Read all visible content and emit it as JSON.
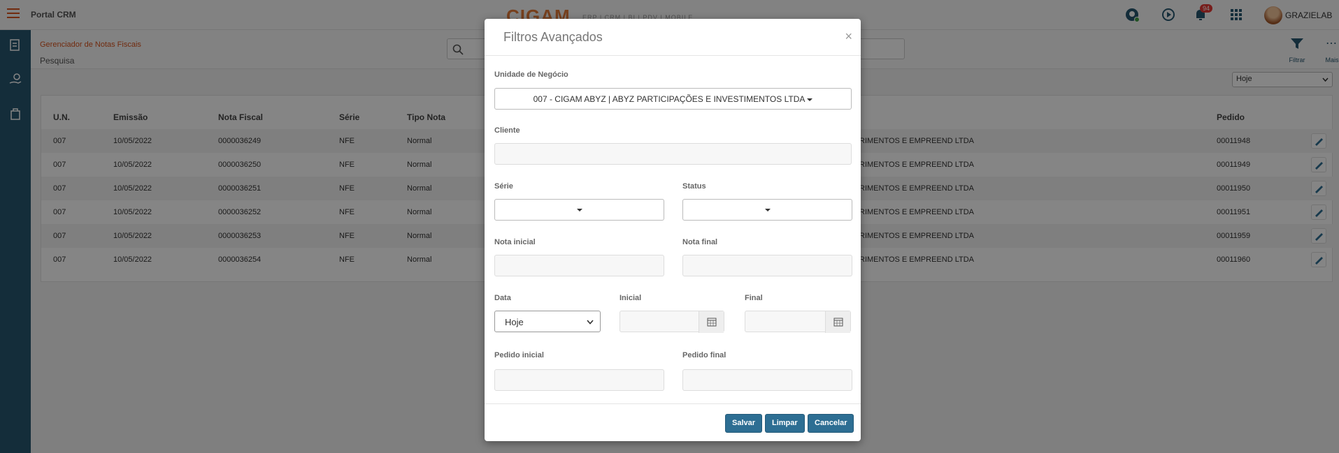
{
  "header": {
    "app_title": "Portal CRM",
    "brand": "CIGAM",
    "brand_sub": "ERP | CRM | BI | PDV | MOBILE",
    "notification_count": "94",
    "username": "GRAZIELAB"
  },
  "subheader": {
    "breadcrumb": "Gerenciador de Notas Fiscais",
    "title": "Pesquisa",
    "filter_label": "Filtrar",
    "more_label": "Mais"
  },
  "period_select": "Hoje",
  "table": {
    "headers": [
      "U.N.",
      "Emissão",
      "Nota Fiscal",
      "Série",
      "Tipo Nota",
      "Pedido"
    ],
    "rows": [
      {
        "un": "007",
        "emissao": "10/05/2022",
        "nota": "0000036249",
        "serie": "NFE",
        "tipo": "Normal",
        "cliente": "RIMENTOS E EMPREEND LTDA",
        "pedido": "00011948"
      },
      {
        "un": "007",
        "emissao": "10/05/2022",
        "nota": "0000036250",
        "serie": "NFE",
        "tipo": "Normal",
        "cliente": "RIMENTOS E EMPREEND LTDA",
        "pedido": "00011949"
      },
      {
        "un": "007",
        "emissao": "10/05/2022",
        "nota": "0000036251",
        "serie": "NFE",
        "tipo": "Normal",
        "cliente": "RIMENTOS E EMPREEND LTDA",
        "pedido": "00011950"
      },
      {
        "un": "007",
        "emissao": "10/05/2022",
        "nota": "0000036252",
        "serie": "NFE",
        "tipo": "Normal",
        "cliente": "RIMENTOS E EMPREEND LTDA",
        "pedido": "00011951"
      },
      {
        "un": "007",
        "emissao": "10/05/2022",
        "nota": "0000036253",
        "serie": "NFE",
        "tipo": "Normal",
        "cliente": "RIMENTOS E EMPREEND LTDA",
        "pedido": "00011959"
      },
      {
        "un": "007",
        "emissao": "10/05/2022",
        "nota": "0000036254",
        "serie": "NFE",
        "tipo": "Normal",
        "cliente": "RIMENTOS E EMPREEND LTDA",
        "pedido": "00011960"
      }
    ]
  },
  "modal": {
    "title": "Filtros Avançados",
    "close": "×",
    "unidade_label": "Unidade de Negócio",
    "unidade_value": "007 - CIGAM ABYZ | ABYZ PARTICIPAÇÕES E INVESTIMENTOS LTDA",
    "cliente_label": "Cliente",
    "serie_label": "Série",
    "status_label": "Status",
    "nota_inicial_label": "Nota inicial",
    "nota_final_label": "Nota final",
    "data_label": "Data",
    "data_value": "Hoje",
    "inicial_label": "Inicial",
    "final_label": "Final",
    "pedido_inicial_label": "Pedido inicial",
    "pedido_final_label": "Pedido final",
    "salvar": "Salvar",
    "limpar": "Limpar",
    "cancelar": "Cancelar"
  },
  "colors": {
    "accent": "#d9541e",
    "sidebar": "#28566f",
    "primary_button": "#2d6e93"
  },
  "icons": [
    "menu-icon",
    "chat-icon",
    "video-icon",
    "bell-icon",
    "apps-grid-icon",
    "search-icon",
    "clear-icon",
    "filter-icon",
    "more-icon",
    "calendar-icon",
    "edit-icon",
    "caret-down-icon"
  ]
}
